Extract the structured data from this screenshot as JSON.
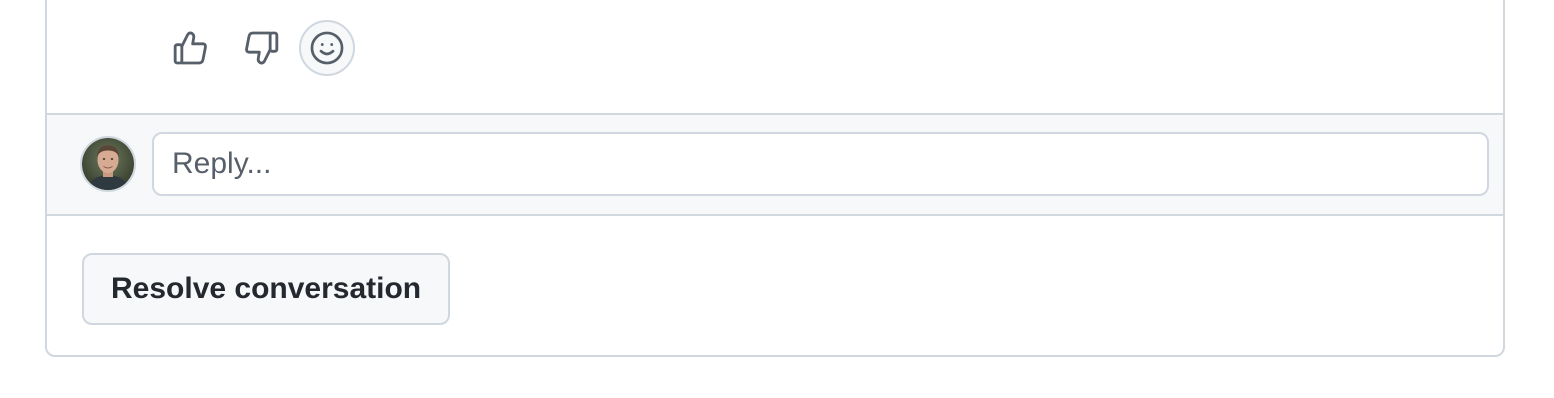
{
  "reactions": [
    {
      "name": "thumbs-up",
      "icon": "thumbs-up-icon"
    },
    {
      "name": "thumbs-down",
      "icon": "thumbs-down-icon"
    },
    {
      "name": "add-reaction",
      "icon": "smiley-icon"
    }
  ],
  "reply": {
    "placeholder": "Reply...",
    "value": ""
  },
  "actions": {
    "resolve_label": "Resolve conversation"
  },
  "colors": {
    "border": "#d0d7de",
    "muted_bg": "#f6f8fa",
    "icon": "#57606a",
    "text": "#24292f"
  }
}
